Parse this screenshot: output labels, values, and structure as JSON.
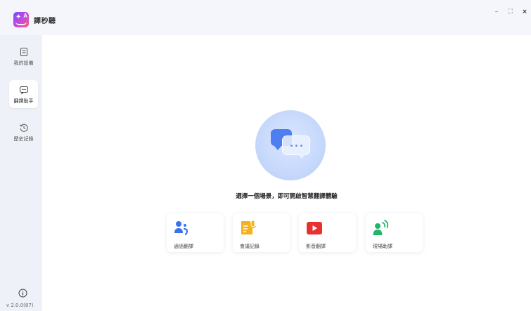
{
  "app": {
    "title": "譯秒聽",
    "logo_letter": "A"
  },
  "window_controls": {
    "minimize": "–",
    "maximize": "⛶",
    "close": "×"
  },
  "sidebar": {
    "items": [
      {
        "label": "我的設備",
        "icon": "device-icon",
        "active": false
      },
      {
        "label": "翻譯助手",
        "icon": "chat-bubble-icon",
        "active": true
      },
      {
        "label": "歷史記錄",
        "icon": "history-icon",
        "active": false
      }
    ],
    "version": "v 2.0.0(87)"
  },
  "main": {
    "hint": "選擇一個場景，即可開啟智慧翻譯體驗",
    "cards": [
      {
        "label": "通話翻譯",
        "icon": "call-translate-icon",
        "color": "#3a73ef"
      },
      {
        "label": "會議記錄",
        "icon": "meeting-record-icon",
        "color": "#f5b21b"
      },
      {
        "label": "影音翻譯",
        "icon": "video-play-icon",
        "color": "#e9302f"
      },
      {
        "label": "現場助譯",
        "icon": "live-speaker-icon",
        "color": "#22b56a"
      }
    ]
  },
  "colors": {
    "accent_blue": "#4f7ef1",
    "sidebar_bg": "#eef1f8",
    "main_bg": "#ffffff"
  }
}
